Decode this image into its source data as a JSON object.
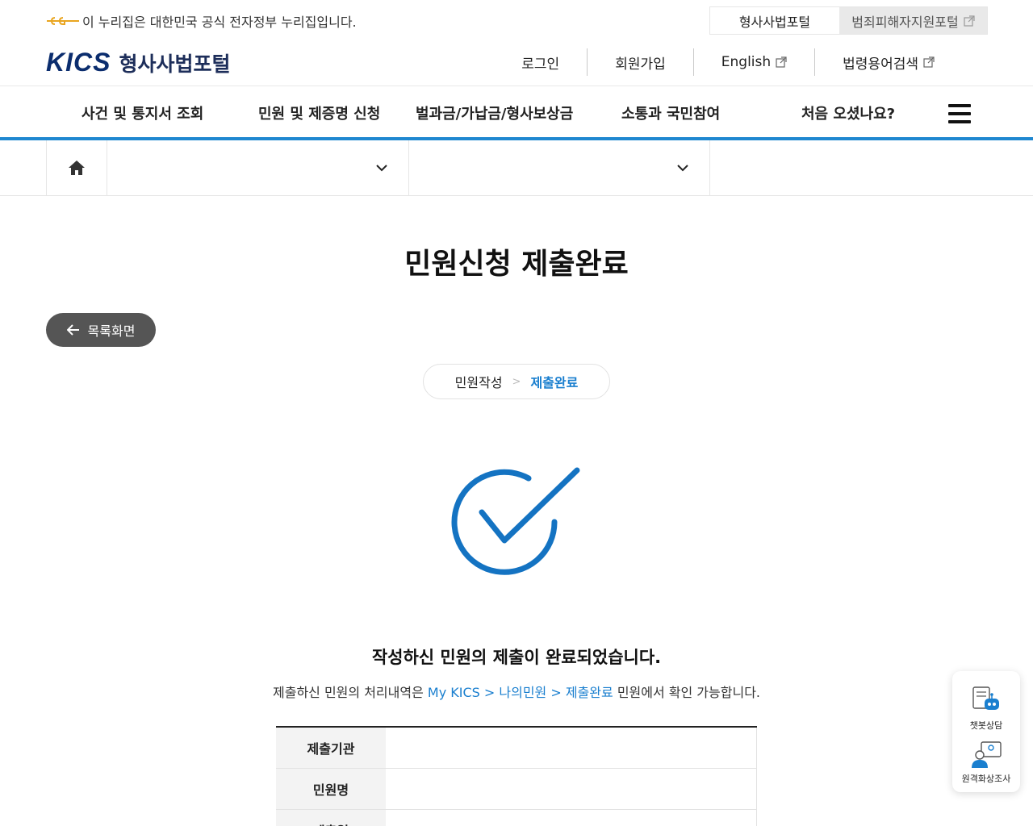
{
  "gov_banner": {
    "text": "이 누리집은 대한민국 공식 전자정부 누리집입니다."
  },
  "portal_switch": {
    "current": "형사사법포털",
    "other": "범죄피해자지원포털"
  },
  "logo": {
    "mark": "KICS",
    "title": "형사사법포털"
  },
  "util_links": {
    "login": "로그인",
    "signup": "회원가입",
    "english": "English",
    "legal_terms": "법령용어검색"
  },
  "gnb": {
    "items": [
      "사건 및 통지서 조회",
      "민원 및 제증명 신청",
      "벌과금/가납금/형사보상금",
      "소통과 국민참여",
      "처음 오셨나요?"
    ]
  },
  "page": {
    "title": "민원신청 제출완료",
    "back_label": "목록화면",
    "steps": {
      "step1": "민원작성",
      "separator": ">",
      "step2": "제출완료"
    },
    "done_message": "작성하신 민원의 제출이 완료되었습니다.",
    "done_sub_before": "제출하신 민원의 처리내역은 ",
    "done_sub_link": "My KICS > 나의민원 > 제출완료",
    "done_sub_after": " 민원에서 확인 가능합니다."
  },
  "info_table": {
    "rows": [
      {
        "label": "제출기관",
        "value": ""
      },
      {
        "label": "민원명",
        "value": ""
      },
      {
        "label": "제출일",
        "value": ""
      }
    ]
  },
  "side_widget": {
    "chatbot": "챗봇상담",
    "remote": "원격화상조사"
  },
  "colors": {
    "accent": "#1a7fcf",
    "gnb_line": "#1f87d0",
    "back_button": "#555555"
  }
}
